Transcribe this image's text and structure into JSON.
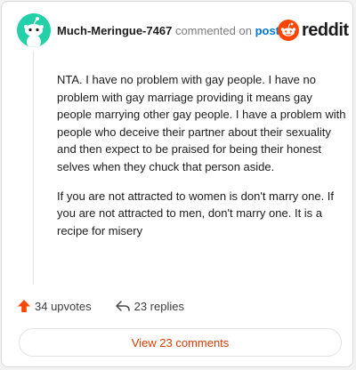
{
  "comment": {
    "username": "Much-Meringue-7467",
    "action_text": "commented on",
    "post_link": "post",
    "brand": "reddit",
    "paragraphs": [
      "NTA. I have no problem with gay people. I have no problem with gay marriage providing it means gay people marrying other gay people. I have a problem with people who deceive their partner about their sexuality and then expect to be praised for being their honest selves when they chuck that person aside.",
      "If you are not attracted to women is don't marry one. If you are not attracted to men, don't marry one. It is a recipe for misery"
    ],
    "upvotes": "34 upvotes",
    "replies": "23 replies",
    "view_button": "View 23 comments"
  },
  "colors": {
    "avatar_bg": "#24d0a7",
    "reddit_orange": "#ff4500",
    "link_blue": "#0079d3",
    "view_text": "#d93a00"
  },
  "icons": [
    "snoo-avatar-icon",
    "reddit-logo-icon",
    "upvote-arrow-icon",
    "reply-arrow-icon"
  ]
}
